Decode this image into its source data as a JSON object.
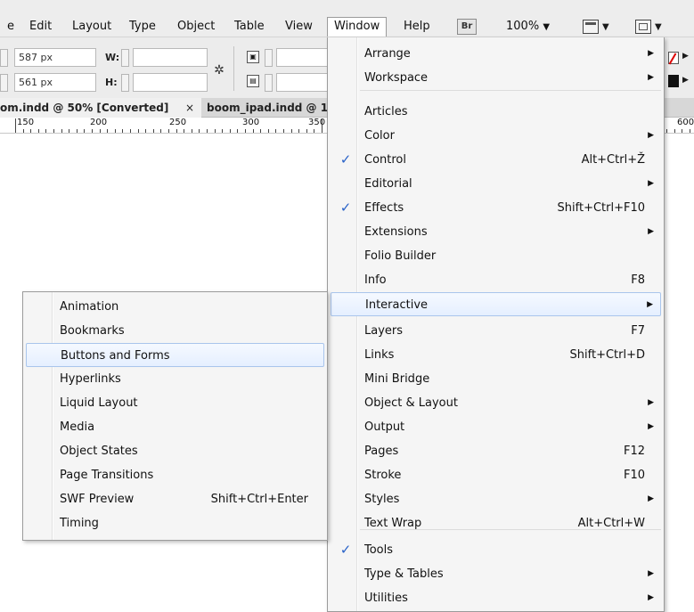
{
  "menubar": {
    "items": [
      "e",
      "Edit",
      "Layout",
      "Type",
      "Object",
      "Table",
      "View",
      "Window",
      "Help"
    ],
    "br_label": "Br",
    "zoom": "100%"
  },
  "control": {
    "x_value": "587 px",
    "y_value": "561 px",
    "w_label": "W:",
    "h_label": "H:"
  },
  "tabs": {
    "tab1": "om.indd @ 50% [Converted]",
    "tab1_close": "×",
    "tab2": "boom_ipad.indd @ 1"
  },
  "ruler": {
    "labels": [
      "150",
      "200",
      "250",
      "300",
      "350",
      "600"
    ]
  },
  "window_menu": {
    "items": [
      {
        "label": "Arrange",
        "shortcut": "",
        "submenu": true,
        "checked": false
      },
      {
        "label": "Workspace",
        "shortcut": "",
        "submenu": true,
        "checked": false
      },
      {
        "label": "Articles",
        "shortcut": "",
        "submenu": false,
        "checked": false
      },
      {
        "label": "Color",
        "shortcut": "",
        "submenu": true,
        "checked": false
      },
      {
        "label": "Control",
        "shortcut": "Alt+Ctrl+Ž",
        "submenu": false,
        "checked": true
      },
      {
        "label": "Editorial",
        "shortcut": "",
        "submenu": true,
        "checked": false
      },
      {
        "label": "Effects",
        "shortcut": "Shift+Ctrl+F10",
        "submenu": false,
        "checked": true
      },
      {
        "label": "Extensions",
        "shortcut": "",
        "submenu": true,
        "checked": false
      },
      {
        "label": "Folio Builder",
        "shortcut": "",
        "submenu": false,
        "checked": false
      },
      {
        "label": "Info",
        "shortcut": "F8",
        "submenu": false,
        "checked": false
      },
      {
        "label": "Interactive",
        "shortcut": "",
        "submenu": true,
        "checked": false
      },
      {
        "label": "Layers",
        "shortcut": "F7",
        "submenu": false,
        "checked": false
      },
      {
        "label": "Links",
        "shortcut": "Shift+Ctrl+D",
        "submenu": false,
        "checked": false
      },
      {
        "label": "Mini Bridge",
        "shortcut": "",
        "submenu": false,
        "checked": false
      },
      {
        "label": "Object & Layout",
        "shortcut": "",
        "submenu": true,
        "checked": false
      },
      {
        "label": "Output",
        "shortcut": "",
        "submenu": true,
        "checked": false
      },
      {
        "label": "Pages",
        "shortcut": "F12",
        "submenu": false,
        "checked": false
      },
      {
        "label": "Stroke",
        "shortcut": "F10",
        "submenu": false,
        "checked": false
      },
      {
        "label": "Styles",
        "shortcut": "",
        "submenu": true,
        "checked": false
      },
      {
        "label": "Text Wrap",
        "shortcut": "Alt+Ctrl+W",
        "submenu": false,
        "checked": false
      },
      {
        "label": "Tools",
        "shortcut": "",
        "submenu": false,
        "checked": true
      },
      {
        "label": "Type & Tables",
        "shortcut": "",
        "submenu": true,
        "checked": false
      },
      {
        "label": "Utilities",
        "shortcut": "",
        "submenu": true,
        "checked": false
      }
    ]
  },
  "interactive_menu": {
    "items": [
      {
        "label": "Animation",
        "shortcut": ""
      },
      {
        "label": "Bookmarks",
        "shortcut": ""
      },
      {
        "label": "Buttons and Forms",
        "shortcut": ""
      },
      {
        "label": "Hyperlinks",
        "shortcut": ""
      },
      {
        "label": "Liquid Layout",
        "shortcut": ""
      },
      {
        "label": "Media",
        "shortcut": ""
      },
      {
        "label": "Object States",
        "shortcut": ""
      },
      {
        "label": "Page Transitions",
        "shortcut": ""
      },
      {
        "label": "SWF Preview",
        "shortcut": "Shift+Ctrl+Enter"
      },
      {
        "label": "Timing",
        "shortcut": ""
      }
    ]
  }
}
